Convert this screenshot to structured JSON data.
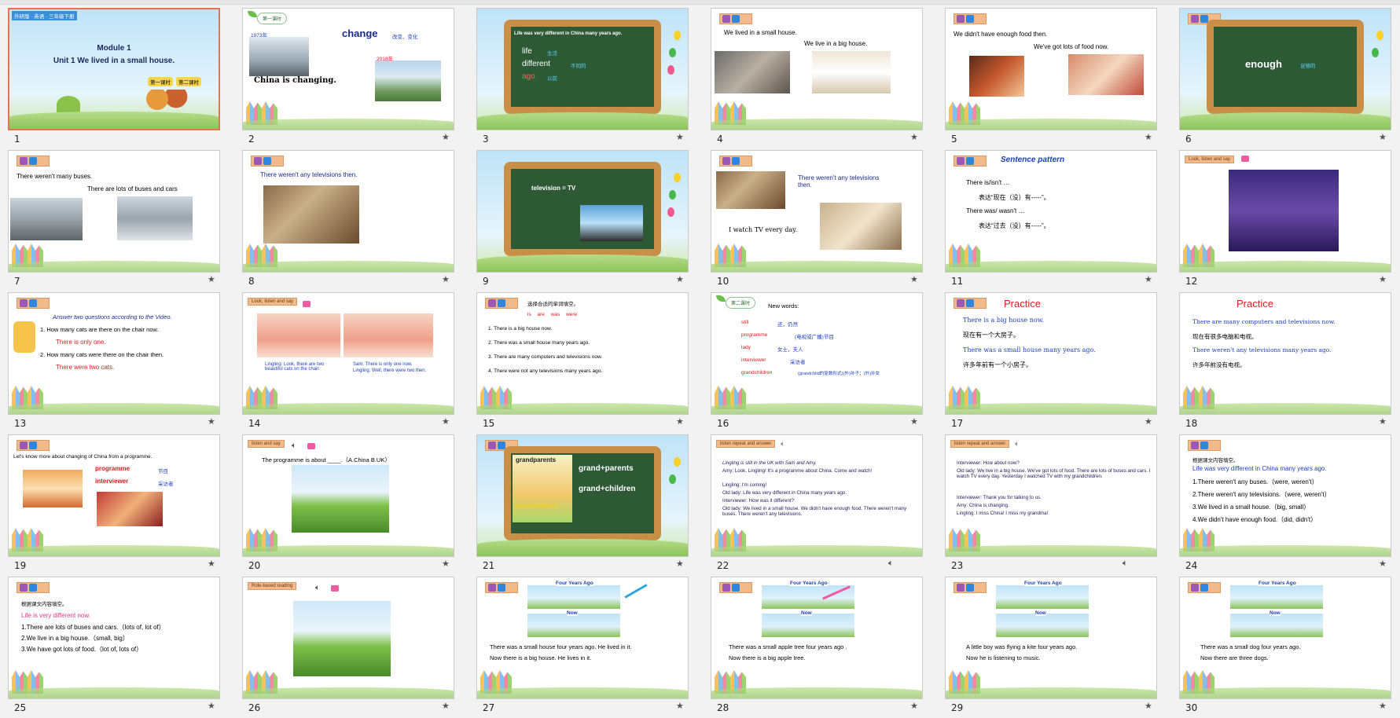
{
  "toolbar": {
    "active_tab": "slides-sorter"
  },
  "slides": [
    {
      "n": "1",
      "pub": "外研版 · 英语 · 三年级下册",
      "title": "Module 1",
      "subtitle": "Unit 1  We lived in a small house.",
      "btn1": "第一课时",
      "btn2": "第二课时"
    },
    {
      "n": "2",
      "badge": "第一课时",
      "y1": "1973年",
      "word": "change",
      "cn": "改变、变化",
      "y2": "2018年",
      "line": "China is changing."
    },
    {
      "n": "3",
      "head": "Life was very different in China many years ago.",
      "w1": "life",
      "c1": "生活",
      "w2": "different",
      "c2": "不同的",
      "w3": "ago",
      "c3": "以前"
    },
    {
      "n": "4",
      "l1": "We lived in a small house.",
      "l2": "We live in a big house."
    },
    {
      "n": "5",
      "l1": "We didn't have enough food then.",
      "l2": "We've got lots of food now."
    },
    {
      "n": "6",
      "w": "enough",
      "c": "足够的"
    },
    {
      "n": "7",
      "l1": "There weren't many buses.",
      "l2": "There are lots of buses and cars"
    },
    {
      "n": "8",
      "l1": "There weren't any televisions then."
    },
    {
      "n": "9",
      "l1": "television = TV"
    },
    {
      "n": "10",
      "l1": "There weren't any televisions then.",
      "l2": "I watch TV every day."
    },
    {
      "n": "11",
      "title": "Sentence pattern",
      "l1": "There is/isn't …",
      "l2": "表达“现在（没）有-----”。",
      "l3": "There was/ wasn't …",
      "l4": "表达“过去（没）有-----”。"
    },
    {
      "n": "12",
      "tag": "Look, listen and say"
    },
    {
      "n": "13",
      "head": "Answer two questions according to the Video.",
      "q1": "1. How many cats are there on the chair now.",
      "a1": "There is only one.",
      "q2": "2. How many cats were there on the chair then.",
      "a2": "There were two cats."
    },
    {
      "n": "14",
      "tag": "Look, listen and say",
      "s1": "Lingling: Look, there are two beautiful cats on the chair.",
      "s2": "Sam: There is only one now.",
      "s3": "Lingling: Well, there were two then."
    },
    {
      "n": "15",
      "head": "选择合适的单词填空。",
      "opts": "is    are    was    were",
      "q1": "1. There  is  a big house now.",
      "q2": "2. There  was  a small house many years ago.",
      "q3": "3. There  are  many computers and televisions now.",
      "q4": "4. There  were  not any televisions many years ago."
    },
    {
      "n": "16",
      "badge": "第二课时",
      "head": "New words:",
      "w1": "still",
      "c1": "还，仍然",
      "w2": "programme",
      "c2": "(电视或广播)节目",
      "w3": "lady",
      "c3": "女士，夫人",
      "w4": "interviewer",
      "c4": "采访者",
      "w5": "grandchildren",
      "c5": "(grandchild的复数形式)(外)孙子；(外)孙女"
    },
    {
      "n": "17",
      "title": "Practice",
      "l1": "There is a big house now.",
      "l2": "现在有一个大房子。",
      "l3": "There was a small house many years ago.",
      "l4": "许多年前有一个小房子。"
    },
    {
      "n": "18",
      "title": "Practice",
      "l1": "There are many computers and televisions now.",
      "l2": "现在有很多电脑和电视。",
      "l3": "There weren't any televisions many years ago.",
      "l4": "许多年前没有电视。"
    },
    {
      "n": "19",
      "head": "Let's know more about changing of  China from a programme.",
      "w1": "programme",
      "c1": "节目",
      "w2": "interviewer",
      "c2": "采访者"
    },
    {
      "n": "20",
      "tag": "listen and say",
      "l1": "The programme is about ____.（A.China  B.UK）"
    },
    {
      "n": "21",
      "w1": "grandparents",
      "f1": "grand+parents",
      "w2": "grandchildren",
      "f2": "grand+children"
    },
    {
      "n": "22",
      "tag": "listen repeat and answer",
      "lines": [
        "Lingling is still in the UK with Sam and Amy.",
        "Amy: Look, Lingling! It's a programme about China. Come and watch!",
        "Lingling: I'm coming!",
        "Old lady: Life was very different in China many years ago.",
        "Interviewer: How was it different?",
        "Old lady: We lived in a small house. We didn't have enough food. There weren't many buses. There weren't any televisions."
      ]
    },
    {
      "n": "23",
      "tag": "listen repeat and answer",
      "lines": [
        "Interviewer: How about now?",
        "Old lady: We live in a big house. We've got lots of food. There are lots of buses and cars. I watch TV every day. Yesterday I watched TV with my grandchildren.",
        "Interviewer: Thank you for talking to us.",
        "Amy: China is changing.",
        "Lingling: I miss China! I miss my grandma!"
      ]
    },
    {
      "n": "24",
      "head": "根据课文内容填空。",
      "sub": "Life was very different in China many years ago.",
      "q1": "1.There weren't any buses.（were, weren't）",
      "q2": "2.There weren't any televisions.（were, weren't）",
      "q3": "3.We lived in a small house.（big, small）",
      "q4": "4.We didn't have enough food.（did, didn't）"
    },
    {
      "n": "25",
      "head": "根据课文内容填空。",
      "sub": "Life is very different now.",
      "q1": "1.There are lots of buses and cars.（lots of, lot of）",
      "q2": "2.We live in a big house.（small, big）",
      "q3": "3.We have got lots of food.（lot of, lots of）"
    },
    {
      "n": "26",
      "tag": "Role-based reading"
    },
    {
      "n": "27",
      "sign1": "Four Years Ago",
      "sign2": "Now",
      "l1": "There was a small house four years ago. He lived in it.",
      "l2": "Now there is a big house. He lives in it."
    },
    {
      "n": "28",
      "sign1": "Four Years Ago",
      "sign2": "Now",
      "l1": "There was a small apple tree four years ago .",
      "l2": "Now there is a big apple tree."
    },
    {
      "n": "29",
      "sign1": "Four Years Ago",
      "sign2": "Now",
      "l1": "A little boy was flying a kite four years ago.",
      "l2": "Now he is listening to music."
    },
    {
      "n": "30",
      "sign1": "Four Years Ago",
      "sign2": "Now",
      "l1": "There was a small dog four years ago.",
      "l2": "Now there are three dogs."
    }
  ],
  "colors": {
    "selected_border": "#e8724b",
    "blue_text": "#1b3fb8",
    "red_text": "#e0191e",
    "board": "#2d5a35"
  },
  "icons": {
    "star": "star-icon",
    "audio": "speaker-icon",
    "video": "video-icon"
  }
}
